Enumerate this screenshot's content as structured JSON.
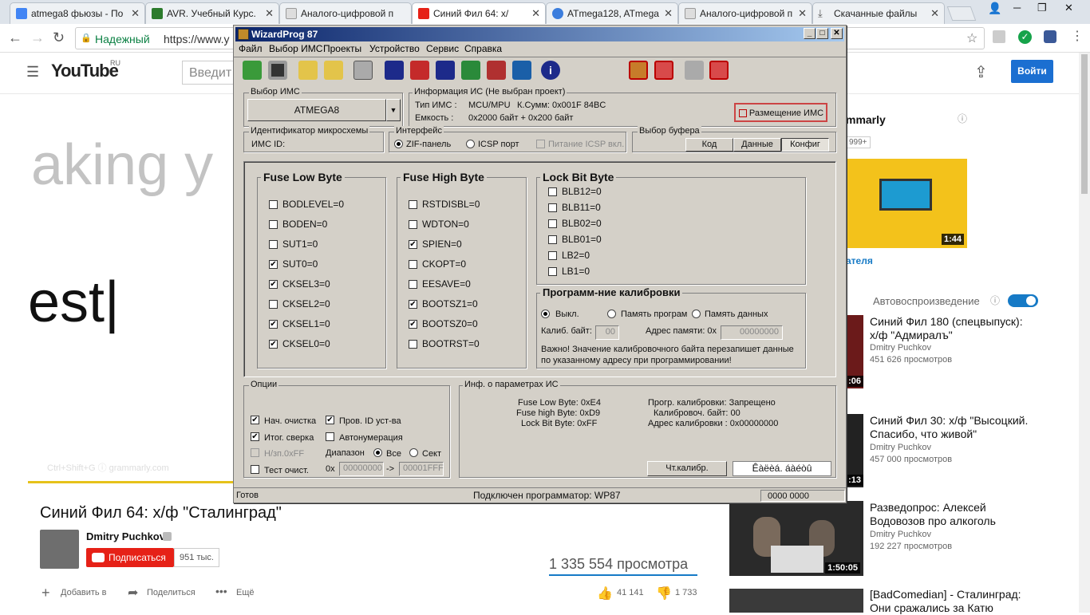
{
  "browser": {
    "tabs": [
      {
        "label": "atmega8 фьюзы - По",
        "icon_color": "#4285f4"
      },
      {
        "label": "AVR. Учебный Курс.",
        "icon_color": "#2c7b2c"
      },
      {
        "label": "Аналого-цифровой п",
        "icon_color": "#999999"
      },
      {
        "label": "Синий Фил 64: х/",
        "icon_color": "#e62117"
      },
      {
        "label": "ATmega128, ATmega",
        "icon_color": "#3b7ddd"
      },
      {
        "label": "Аналого-цифровой п",
        "icon_color": "#999999"
      },
      {
        "label": "Скачанные файлы",
        "icon_color": "#555555"
      }
    ],
    "secure_label": "Надежный",
    "url": "https://www.y",
    "window_controls": [
      "─",
      "❐",
      "✕"
    ]
  },
  "youtube": {
    "logo": "YouTube",
    "logo_region": "RU",
    "search_placeholder": "Введит",
    "signin": "Войти",
    "player_text_1": "aking y",
    "player_text_2": "est",
    "player_watermark": "Ctrl+Shift+G ⓘ grammarly.com",
    "video_title": "Синий Фил 64: х/ф \"Сталинград\"",
    "channel": "Dmitry Puchkov",
    "subscribe": "Подписаться",
    "subscribers": "951 тыс.",
    "views": "1 335 554 просмотра",
    "add_to": "Добавить в",
    "share": "Поделиться",
    "more": "Ещё",
    "likes": "41 141",
    "dislikes": "1 733",
    "ad_title": "mmarly",
    "ad_badge": "999+",
    "ad_duration": "1:44",
    "ad_author": "ателя",
    "autoplay": "Автовоспроизведение",
    "related": [
      {
        "title": "Синий Фил 180 (спецвыпуск): х/ф \"Адмиралъ\"",
        "channel": "Dmitry Puchkov",
        "views": "451 626 просмотров",
        "duration": ":06"
      },
      {
        "title": "Синий Фил 30: х/ф \"Высоцкий. Спасибо, что живой\"",
        "channel": "Dmitry Puchkov",
        "views": "457 000 просмотров",
        "duration": ":13"
      },
      {
        "title": "Разведопрос: Алексей Водовозов про алкоголь",
        "channel": "Dmitry Puchkov",
        "views": "192 227 просмотров",
        "duration": "1:50:05"
      },
      {
        "title": "[BadComedian] - Сталинград: Они сражались за Катю",
        "channel": "",
        "views": "",
        "duration": ""
      }
    ]
  },
  "wizard": {
    "title": "WizardProg 87",
    "menu": [
      "Файл",
      "Выбор ИМС",
      "Проекты",
      "Устройство",
      "Сервис",
      "Справка"
    ],
    "chip_group": "Выбор ИМС",
    "chip": "ATMEGA8",
    "info_group": "Информация ИС (Не выбран проект)",
    "chip_type_label": "Тип ИМС :",
    "chip_type": "MCU/MPU",
    "checksum_label": "К.Сумм:",
    "checksum": "0x001F 84BC",
    "capacity_label": "Емкость :",
    "capacity": "0x2000 байт  + 0x200 байт",
    "placement_btn": "Размещение ИМС",
    "id_group": "Идентификатор микросхемы",
    "id_label": "ИМС ID:",
    "iface_group": "Интерфейс",
    "iface_zif": "ZIF-панель",
    "iface_icsp": "ICSP порт",
    "icsp_power": "Питание ICSP вкл.",
    "buffer_group": "Выбор буфера",
    "buffer_tabs": [
      "Код",
      "Данные",
      "Конфиг"
    ],
    "fuse_low_title": "Fuse Low Byte",
    "fuse_low": [
      {
        "label": "BODLEVEL=0",
        "checked": false
      },
      {
        "label": "BODEN=0",
        "checked": false
      },
      {
        "label": "SUT1=0",
        "checked": false
      },
      {
        "label": "SUT0=0",
        "checked": true
      },
      {
        "label": "CKSEL3=0",
        "checked": true
      },
      {
        "label": "CKSEL2=0",
        "checked": false
      },
      {
        "label": "CKSEL1=0",
        "checked": true
      },
      {
        "label": "CKSEL0=0",
        "checked": true
      }
    ],
    "fuse_high_title": "Fuse High Byte",
    "fuse_high": [
      {
        "label": "RSTDISBL=0",
        "checked": false
      },
      {
        "label": "WDTON=0",
        "checked": false
      },
      {
        "label": "SPIEN=0",
        "checked": true
      },
      {
        "label": "CKOPT=0",
        "checked": false
      },
      {
        "label": "EESAVE=0",
        "checked": false
      },
      {
        "label": "BOOTSZ1=0",
        "checked": true
      },
      {
        "label": "BOOTSZ0=0",
        "checked": true
      },
      {
        "label": "BOOTRST=0",
        "checked": false
      }
    ],
    "lock_title": "Lock Bit Byte",
    "lock": [
      {
        "label": "BLB12=0",
        "checked": false
      },
      {
        "label": "BLB11=0",
        "checked": false
      },
      {
        "label": "BLB02=0",
        "checked": false
      },
      {
        "label": "BLB01=0",
        "checked": false
      },
      {
        "label": "LB2=0",
        "checked": false
      },
      {
        "label": "LB1=0",
        "checked": false
      }
    ],
    "calib_title": "Программ-ние калибровки",
    "calib_off": "Выкл.",
    "calib_prog": "Память програм",
    "calib_data": "Память данных",
    "calib_byte_label": "Калиб. байт:",
    "calib_byte": "00",
    "calib_addr_label": "Адрес памяти: 0x",
    "calib_addr": "00000000",
    "calib_note_1": "Важно! Значение калибровочного байта перезапишет данные",
    "calib_note_2": "по указанному адресу при программировании!",
    "options_group": "Опции",
    "opt_init_clear": "Нач. очистка",
    "opt_id_check": "Пров. ID уст-ва",
    "opt_verify": "Итог. сверка",
    "opt_autonum": "Автонумерация",
    "opt_hfill": "H/зп.0xFF",
    "opt_range": "Диапазон",
    "opt_all": "Все",
    "opt_sect": "Сект",
    "opt_test": "Тест очист.",
    "opt_0x": "0x",
    "range_from": "00000000",
    "range_arrow": "->",
    "range_to": "00001FFF",
    "params_group": "Инф. о параметрах ИС",
    "p_low": "Fuse Low Byte: 0xE4",
    "p_high": "Fuse high Byte: 0xD9",
    "p_lock": "Lock Bit Byte: 0xFF",
    "p_calib": "Прогр. калибровки: Запрещено",
    "p_calib_byte": "Калибровоч. байт:  00",
    "p_calib_addr": "Адрес калибровки   : 0x00000000",
    "read_calib_btn": "Чт.калибр.",
    "garbled_field": "Êàëèá. áàéòû",
    "status_ready": "Готов",
    "status_prog": "Подключен программатор:  WP87",
    "status_counter": "0000 0000"
  }
}
